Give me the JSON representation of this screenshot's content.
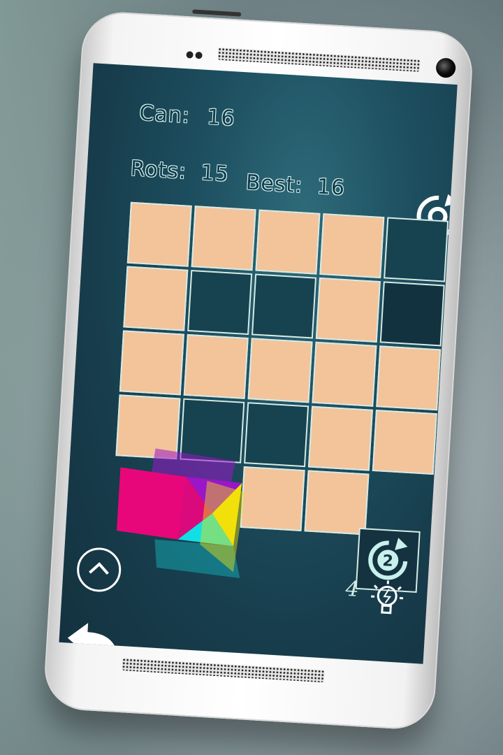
{
  "hud": {
    "can_label": "Can:",
    "can_value": "16",
    "rots_label": "Rots:",
    "rots_value": "15",
    "best_label": "Best:",
    "best_value": "16"
  },
  "board": {
    "rows": 5,
    "cols": 5,
    "cells": [
      [
        "orange",
        "orange",
        "orange",
        "orange",
        "dark"
      ],
      [
        "orange",
        "dark",
        "dark",
        "orange",
        "darker"
      ],
      [
        "orange",
        "orange",
        "orange",
        "orange",
        "orange"
      ],
      [
        "orange",
        "dark",
        "dark",
        "orange",
        "orange"
      ],
      [
        "piece",
        "piece",
        "orange",
        "orange",
        "rotate"
      ]
    ]
  },
  "controls": {
    "rotate_badge": "2",
    "hints_count": "4"
  },
  "colors": {
    "tile": "#f3c39a",
    "magenta": "#e8077a",
    "purple": "#9b16c9",
    "yellow": "#f2e10a",
    "cyan": "#10e0e6",
    "outline": "#d5ebe6"
  }
}
